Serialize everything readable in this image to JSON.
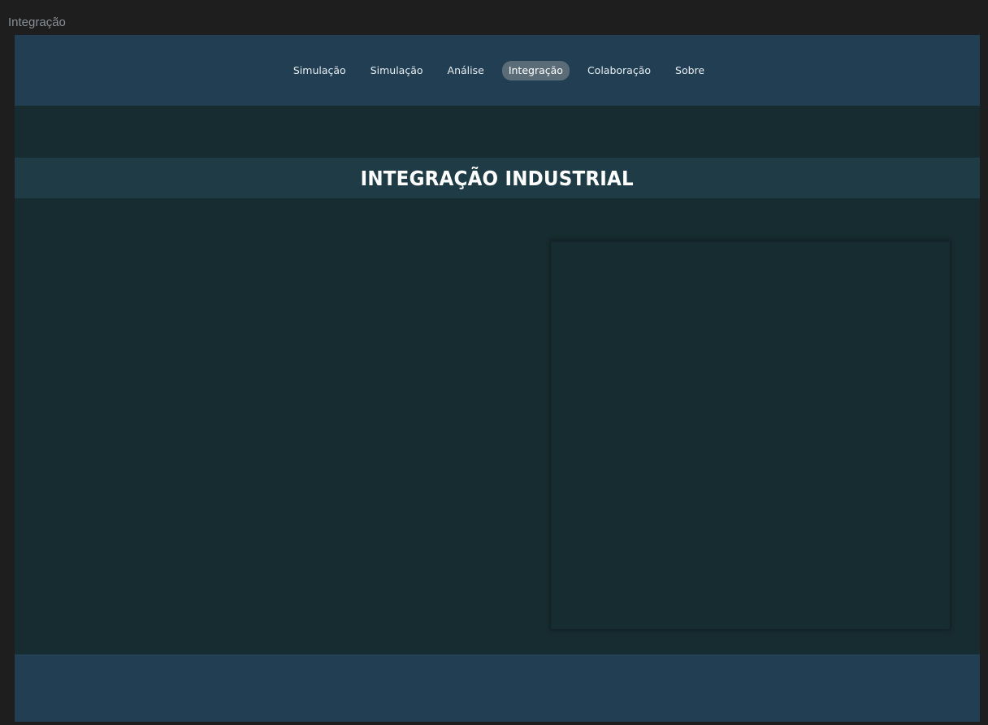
{
  "window": {
    "title": "Integração"
  },
  "nav": {
    "items": [
      {
        "label": "Simulação",
        "active": false
      },
      {
        "label": "Simulação",
        "active": false
      },
      {
        "label": "Análise",
        "active": false
      },
      {
        "label": "Integração",
        "active": true
      },
      {
        "label": "Colaboração",
        "active": false
      },
      {
        "label": "Sobre",
        "active": false
      }
    ]
  },
  "hero": {
    "title": "INTEGRAÇÃO INDUSTRIAL"
  },
  "colors": {
    "nav_background": "#213e53",
    "page_background": "#172c31",
    "hero_band": "#1f3b45",
    "active_pill": "#5a6c78",
    "footer_background": "#213e53"
  }
}
